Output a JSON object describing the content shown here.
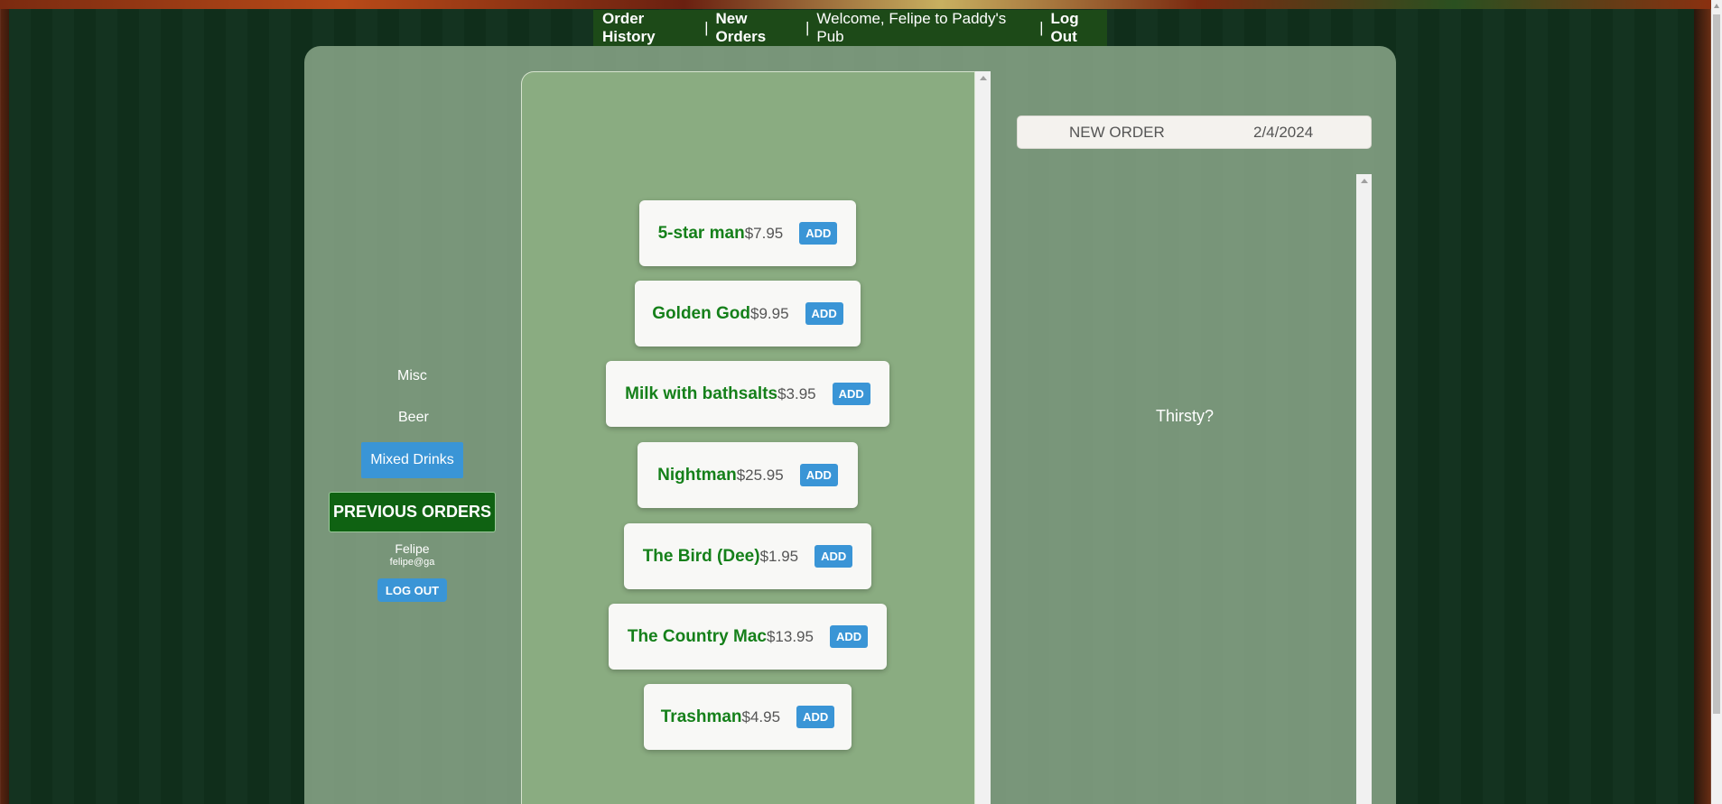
{
  "nav": {
    "order_history": "Order History",
    "sep1": "|",
    "new_orders": "New Orders",
    "sep2": "|",
    "welcome": "Welcome, Felipe to Paddy's Pub",
    "sep3": "|",
    "log_out": "Log Out"
  },
  "sidebar": {
    "categories": [
      "Misc",
      "Beer",
      "Mixed Drinks"
    ],
    "active_category": "Mixed Drinks",
    "previous_orders": "PREVIOUS ORDERS",
    "user_name": "Felipe",
    "user_email": "felipe@ga",
    "log_out": "LOG OUT"
  },
  "menu": {
    "add_label": "ADD",
    "items": [
      {
        "name": "5-star man",
        "price": "$7.95"
      },
      {
        "name": "Golden God",
        "price": "$9.95"
      },
      {
        "name": "Milk with bathsalts",
        "price": "$3.95"
      },
      {
        "name": "Nightman",
        "price": "$25.95"
      },
      {
        "name": "The Bird (Dee)",
        "price": "$1.95"
      },
      {
        "name": "The Country Mac",
        "price": "$13.95"
      },
      {
        "name": "Trashman",
        "price": "$4.95"
      }
    ]
  },
  "order": {
    "label": "NEW ORDER",
    "date": "2/4/2024",
    "empty_message": "Thirsty?"
  },
  "colors": {
    "accent_blue": "#3a95d6",
    "item_green": "#15801a",
    "nav_green": "#1d4a18",
    "prev_orders_green": "#0f6212"
  }
}
